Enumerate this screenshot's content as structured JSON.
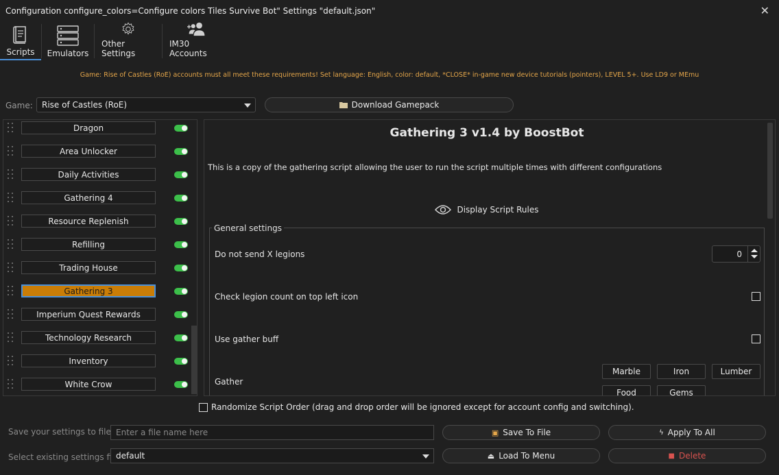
{
  "window": {
    "title": "Configuration configure_colors=Configure colors Tiles Survive Bot\" Settings \"default.json\""
  },
  "toolbar": [
    {
      "label": "Scripts",
      "icon": "scroll-icon",
      "active": true
    },
    {
      "label": "Emulators",
      "icon": "server-icon",
      "active": false
    },
    {
      "label": "Other Settings",
      "icon": "gear-icon",
      "active": false
    },
    {
      "label": "IM30 Accounts",
      "icon": "users-add-icon",
      "active": false
    }
  ],
  "notice": "Game: Rise of Castles (RoE) accounts must all meet these requirements! Set language: English, color: default, *CLOSE* in-game new device tutorials (pointers), LEVEL 5+. Use LD9 or MEmu",
  "game": {
    "label": "Game:",
    "value": "Rise of Castles (RoE)",
    "download_label": "Download Gamepack"
  },
  "scripts": [
    {
      "label": "Dragon",
      "enabled": true,
      "selected": false
    },
    {
      "label": "Area Unlocker",
      "enabled": true,
      "selected": false
    },
    {
      "label": "Daily Activities",
      "enabled": true,
      "selected": false
    },
    {
      "label": "Gathering 4",
      "enabled": true,
      "selected": false
    },
    {
      "label": "Resource Replenish",
      "enabled": true,
      "selected": false
    },
    {
      "label": "Refilling",
      "enabled": true,
      "selected": false
    },
    {
      "label": "Trading House",
      "enabled": true,
      "selected": false
    },
    {
      "label": "Gathering 3",
      "enabled": true,
      "selected": true
    },
    {
      "label": "Imperium Quest Rewards",
      "enabled": true,
      "selected": false
    },
    {
      "label": "Technology Research",
      "enabled": true,
      "selected": false
    },
    {
      "label": "Inventory",
      "enabled": true,
      "selected": false
    },
    {
      "label": "White Crow",
      "enabled": true,
      "selected": false
    }
  ],
  "detail": {
    "title": "Gathering 3 v1.4 by BoostBot",
    "description": "This is a copy of the gathering script allowing the user to run the script multiple times with different configurations",
    "rules_label": "Display Script Rules",
    "group_label": "General settings",
    "opt_legions": "Do not send X legions",
    "legions_value": "0",
    "opt_check": "Check legion count on top left icon",
    "opt_buff": "Use gather buff",
    "opt_gather": "Gather",
    "gather_buttons": [
      "Marble",
      "Iron",
      "Lumber",
      "Food",
      "Gems"
    ]
  },
  "bottom": {
    "randomize": "Randomize Script Order (drag and drop order will be ignored except for account config and switching).",
    "save_label": "Save your settings to file",
    "save_placeholder": "Enter a file name here",
    "select_label": "Select existing settings file",
    "select_value": "default",
    "save_btn": "Save To File",
    "apply_btn": "Apply To All",
    "load_btn": "Load To Menu",
    "delete_btn": "Delete"
  },
  "colors": {
    "accent": "#c97d07",
    "toggle_on": "#3cbf4a",
    "notice": "#e6a74a",
    "delete": "#d9534f"
  }
}
